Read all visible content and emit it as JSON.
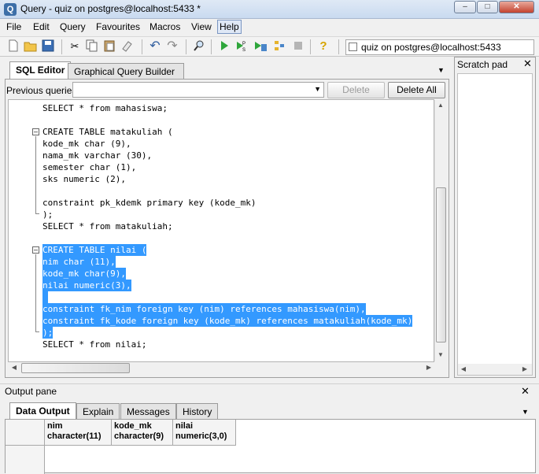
{
  "window": {
    "title": "Query - quiz on postgres@localhost:5433 *"
  },
  "menu": [
    "File",
    "Edit",
    "Query",
    "Favourites",
    "Macros",
    "View",
    "Help"
  ],
  "menu_selected": "Help",
  "toolbar": {
    "connection": "quiz on postgres@localhost:5433",
    "icons": [
      "new-file-icon",
      "open-folder-icon",
      "save-icon",
      "cut-icon",
      "copy-icon",
      "paste-icon",
      "clear-icon",
      "undo-icon",
      "redo-icon",
      "find-icon",
      "execute-icon",
      "execute-pgscript-icon",
      "execute-to-file-icon",
      "explain-icon",
      "cancel-query-icon",
      "help-icon"
    ]
  },
  "editor_tabs": [
    {
      "label": "SQL Editor",
      "active": true
    },
    {
      "label": "Graphical Query Builder",
      "active": false
    }
  ],
  "previous_queries": {
    "label": "Previous queries",
    "value": ""
  },
  "buttons": {
    "delete": "Delete",
    "delete_all": "Delete All"
  },
  "code_lines": [
    {
      "text": "SELECT * from mahasiswa;",
      "hl": false
    },
    {
      "text": "",
      "hl": false
    },
    {
      "text": "CREATE TABLE matakuliah (",
      "hl": false
    },
    {
      "text": "kode_mk char (9),",
      "hl": false
    },
    {
      "text": "nama_mk varchar (30),",
      "hl": false
    },
    {
      "text": "semester char (1),",
      "hl": false
    },
    {
      "text": "sks numeric (2),",
      "hl": false
    },
    {
      "text": "",
      "hl": false
    },
    {
      "text": "constraint pk_kdemk primary key (kode_mk)",
      "hl": false
    },
    {
      "text": ");",
      "hl": false
    },
    {
      "text": "SELECT * from matakuliah;",
      "hl": false
    },
    {
      "text": "",
      "hl": false
    },
    {
      "text": "CREATE TABLE nilai (",
      "hl": true
    },
    {
      "text": "nim char (11),",
      "hl": true
    },
    {
      "text": "kode_mk char(9),",
      "hl": true
    },
    {
      "text": "nilai numeric(3),",
      "hl": true
    },
    {
      "text": " ",
      "hl": true
    },
    {
      "text": "constraint fk_nim foreign key (nim) references mahasiswa(nim),",
      "hl": true
    },
    {
      "text": "constraint fk_kode foreign key (kode_mk) references matakuliah(kode_mk)",
      "hl": true
    },
    {
      "text": ");",
      "hl": true
    },
    {
      "text": "SELECT * from nilai;",
      "hl": false
    }
  ],
  "scratch_pad": {
    "title": "Scratch pad"
  },
  "output": {
    "title": "Output pane",
    "tabs": [
      {
        "label": "Data Output",
        "active": true
      },
      {
        "label": "Explain",
        "active": false
      },
      {
        "label": "Messages",
        "active": false
      },
      {
        "label": "History",
        "active": false
      }
    ],
    "columns": [
      {
        "name": "nim",
        "type": "character(11)"
      },
      {
        "name": "kode_mk",
        "type": "character(9)"
      },
      {
        "name": "nilai",
        "type": "numeric(3,0)"
      }
    ]
  }
}
